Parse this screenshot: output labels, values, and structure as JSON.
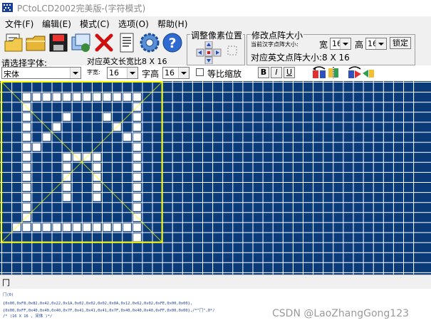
{
  "window": {
    "title": "PCtoLCD2002完美版-(字符模式)"
  },
  "menu": [
    {
      "label": "文件(F)"
    },
    {
      "label": "编辑(E)"
    },
    {
      "label": "模式(C)"
    },
    {
      "label": "选项(O)"
    },
    {
      "label": "帮助(H)"
    }
  ],
  "toolbar": {
    "icons": [
      "open-file",
      "save",
      "new",
      "delete",
      "text-document",
      "settings-gear",
      "help"
    ]
  },
  "position_group": {
    "legend": "调整像素位置"
  },
  "size_group": {
    "legend": "修改点阵大小",
    "current_label": "当前汉字点阵大小:",
    "width_label": "宽",
    "width_value": "16",
    "height_label": "高",
    "height_value": "16",
    "lock_label": "锁定",
    "ascii_size_label": "对应英文点阵大小:8 X 16"
  },
  "font": {
    "prompt": "请选择字体:",
    "name": "宋体",
    "ascii_width_label": "对应英文长宽比8 X 16",
    "char_width_label": "字宽:",
    "char_width_value": "16",
    "char_height_label": "字高",
    "char_height_value": "16",
    "proportional_label": "等比缩放",
    "proportional_checked": false
  },
  "format_buttons": {
    "bold": "B",
    "italic": "I",
    "underline": "U"
  },
  "grid": {
    "background": "#0a3a78",
    "cell_off": "#0a3a78",
    "cell_on": "#ffffff",
    "selection_color": "#ffff00",
    "columns": 41,
    "rows": 18,
    "selection_cols": 16,
    "selection_rows": 16,
    "char_bitmap": [
      "0000000000000000",
      "0011111111111100",
      "0010000000000100",
      "0010001000100100",
      "0010010000010100",
      "0010100000001100",
      "0011000000000100",
      "0010001111000100",
      "0010001001000100",
      "0010001001000100",
      "0010001001000100",
      "0010001001000100",
      "0010000000000100",
      "0010000000000100",
      "0111111111111100",
      "0000000000000100"
    ]
  },
  "output": {
    "header_label": "冂",
    "lines": [
      "冂(0)",
      "",
      "{0x00,0xF8,0x82,0x42,0x22,0x1A,0x02,0x02,0x02,0x0A,0x12,0x62,0x02,0xFE,0x00,0x00},",
      "{0x00,0xFF,0x40,0x40,0x40,0x7F,0x41,0x41,0x41,0x7F,0x40,0x40,0x40,0xFF,0x00,0x00},/*\"冂\",0*/",
      "/* (16 X 16 , 宋体 )*/"
    ]
  },
  "watermark": "CSDN @LaoZhangGong123"
}
